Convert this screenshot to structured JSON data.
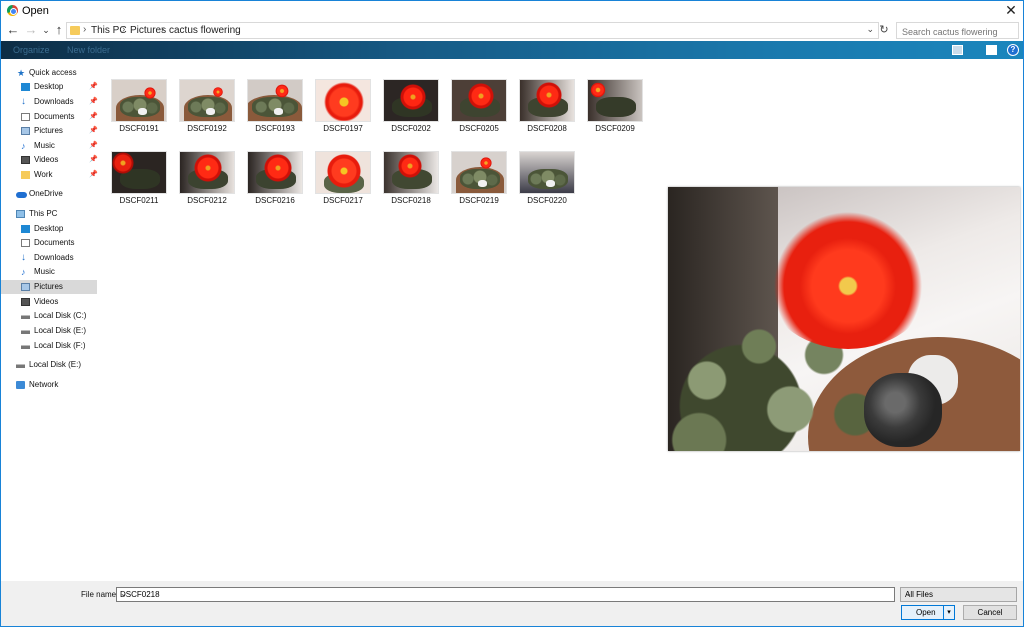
{
  "window": {
    "title": "Open",
    "close_label": "✕"
  },
  "address": {
    "crumbs": [
      "This PC",
      "Pictures",
      "cactus flowering"
    ],
    "search_placeholder": "Search cactus flowering"
  },
  "commandbar": {
    "organize_label": "Organize",
    "new_folder_label": "New folder"
  },
  "nav": {
    "quick_access": "Quick access",
    "quick_items": [
      "Desktop",
      "Downloads",
      "Documents",
      "Pictures",
      "Music",
      "Videos",
      "Work"
    ],
    "onedrive": "OneDrive",
    "this_pc": "This PC",
    "pc_items": [
      "Desktop",
      "Documents",
      "Downloads",
      "Music",
      "Pictures",
      "Videos",
      "Local Disk (C:)",
      "Local Disk (E:)",
      "Local Disk (F:)"
    ],
    "extra_disk": "Local Disk (E:)",
    "network": "Network",
    "selected": "Pictures"
  },
  "files": [
    "DSCF0191",
    "DSCF0192",
    "DSCF0193",
    "DSCF0197",
    "DSCF0202",
    "DSCF0205",
    "DSCF0208",
    "DSCF0209",
    "DSCF0211",
    "DSCF0212",
    "DSCF0216",
    "DSCF0217",
    "DSCF0218",
    "DSCF0219",
    "DSCF0220"
  ],
  "bottom": {
    "filename_label": "File name:",
    "filename_value": "DSCF0218",
    "filter_value": "All Files",
    "open_label": "Open",
    "cancel_label": "Cancel"
  }
}
